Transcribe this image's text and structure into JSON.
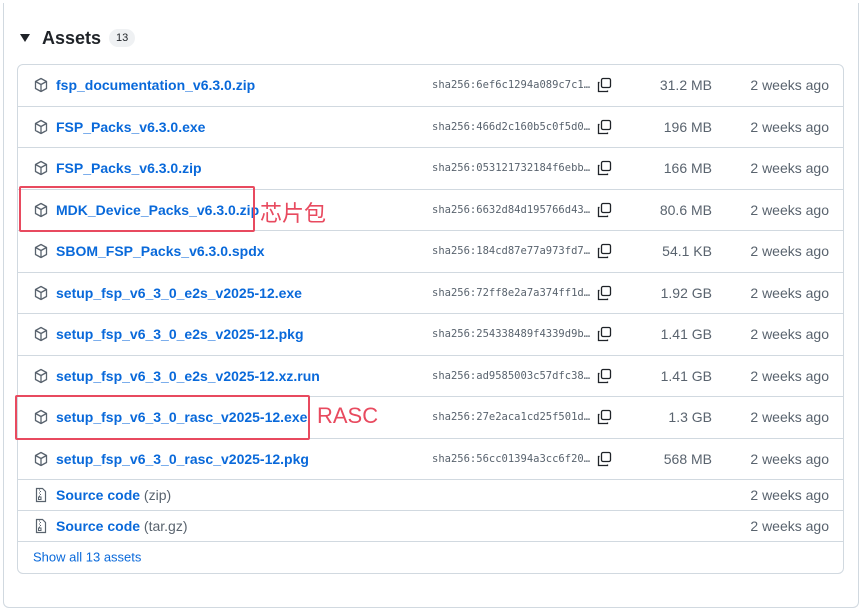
{
  "section": {
    "title": "Assets",
    "count": "13"
  },
  "assets": [
    {
      "name": "fsp_documentation_v6.3.0.zip",
      "sha": "sha256:6ef6c1294a089c7c1…",
      "size": "31.2 MB",
      "date": "2 weeks ago"
    },
    {
      "name": "FSP_Packs_v6.3.0.exe",
      "sha": "sha256:466d2c160b5c0f5d0…",
      "size": "196 MB",
      "date": "2 weeks ago"
    },
    {
      "name": "FSP_Packs_v6.3.0.zip",
      "sha": "sha256:053121732184f6ebb…",
      "size": "166 MB",
      "date": "2 weeks ago"
    },
    {
      "name": "MDK_Device_Packs_v6.3.0.zip",
      "sha": "sha256:6632d84d195766d43…",
      "size": "80.6 MB",
      "date": "2 weeks ago"
    },
    {
      "name": "SBOM_FSP_Packs_v6.3.0.spdx",
      "sha": "sha256:184cd87e77a973fd7…",
      "size": "54.1 KB",
      "date": "2 weeks ago"
    },
    {
      "name": "setup_fsp_v6_3_0_e2s_v2025-12.exe",
      "sha": "sha256:72ff8e2a7a374ff1d…",
      "size": "1.92 GB",
      "date": "2 weeks ago"
    },
    {
      "name": "setup_fsp_v6_3_0_e2s_v2025-12.pkg",
      "sha": "sha256:254338489f4339d9b…",
      "size": "1.41 GB",
      "date": "2 weeks ago"
    },
    {
      "name": "setup_fsp_v6_3_0_e2s_v2025-12.xz.run",
      "sha": "sha256:ad9585003c57dfc38…",
      "size": "1.41 GB",
      "date": "2 weeks ago"
    },
    {
      "name": "setup_fsp_v6_3_0_rasc_v2025-12.exe",
      "sha": "sha256:27e2aca1cd25f501d…",
      "size": "1.3 GB",
      "date": "2 weeks ago"
    },
    {
      "name": "setup_fsp_v6_3_0_rasc_v2025-12.pkg",
      "sha": "sha256:56cc01394a3cc6f20…",
      "size": "568 MB",
      "date": "2 weeks ago"
    }
  ],
  "source": [
    {
      "name": "Source code",
      "suffix": "(zip)",
      "date": "2 weeks ago"
    },
    {
      "name": "Source code",
      "suffix": "(tar.gz)",
      "date": "2 weeks ago"
    }
  ],
  "show_all": "Show all 13 assets",
  "annotations": {
    "mdk_note": "芯片包",
    "rasc_note": "RASC",
    "color": "#e84a5f"
  },
  "icons": {
    "asset": "package-icon",
    "source": "file-zip-icon",
    "copy": "copy-icon",
    "caret": "triangle-down-icon"
  }
}
